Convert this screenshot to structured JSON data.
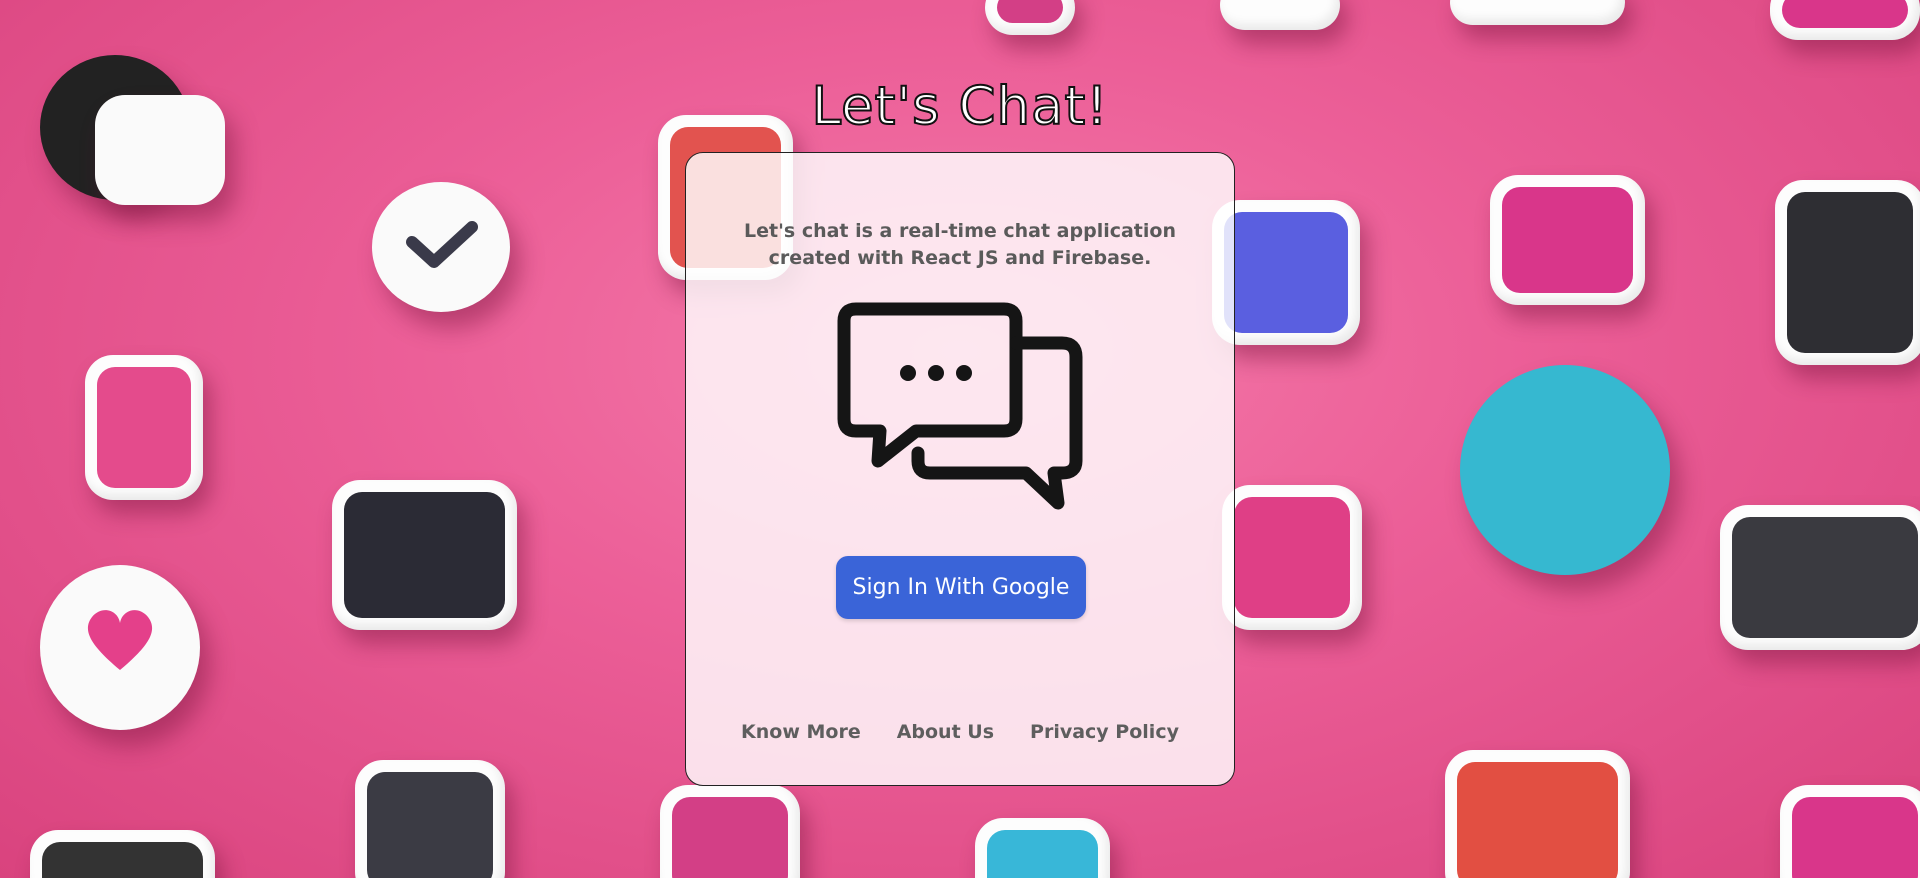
{
  "page": {
    "title": "Let's Chat!"
  },
  "card": {
    "description": "Let's chat is a real-time chat application created with React JS and Firebase.",
    "icon": "chat-bubbles-icon",
    "signin_label": "Sign In With Google",
    "links": [
      {
        "label": "Know More"
      },
      {
        "label": "About Us"
      },
      {
        "label": "Privacy Policy"
      }
    ]
  },
  "colors": {
    "background": "#e8568f",
    "button": "#3a64d8",
    "card": "#ffffff"
  }
}
